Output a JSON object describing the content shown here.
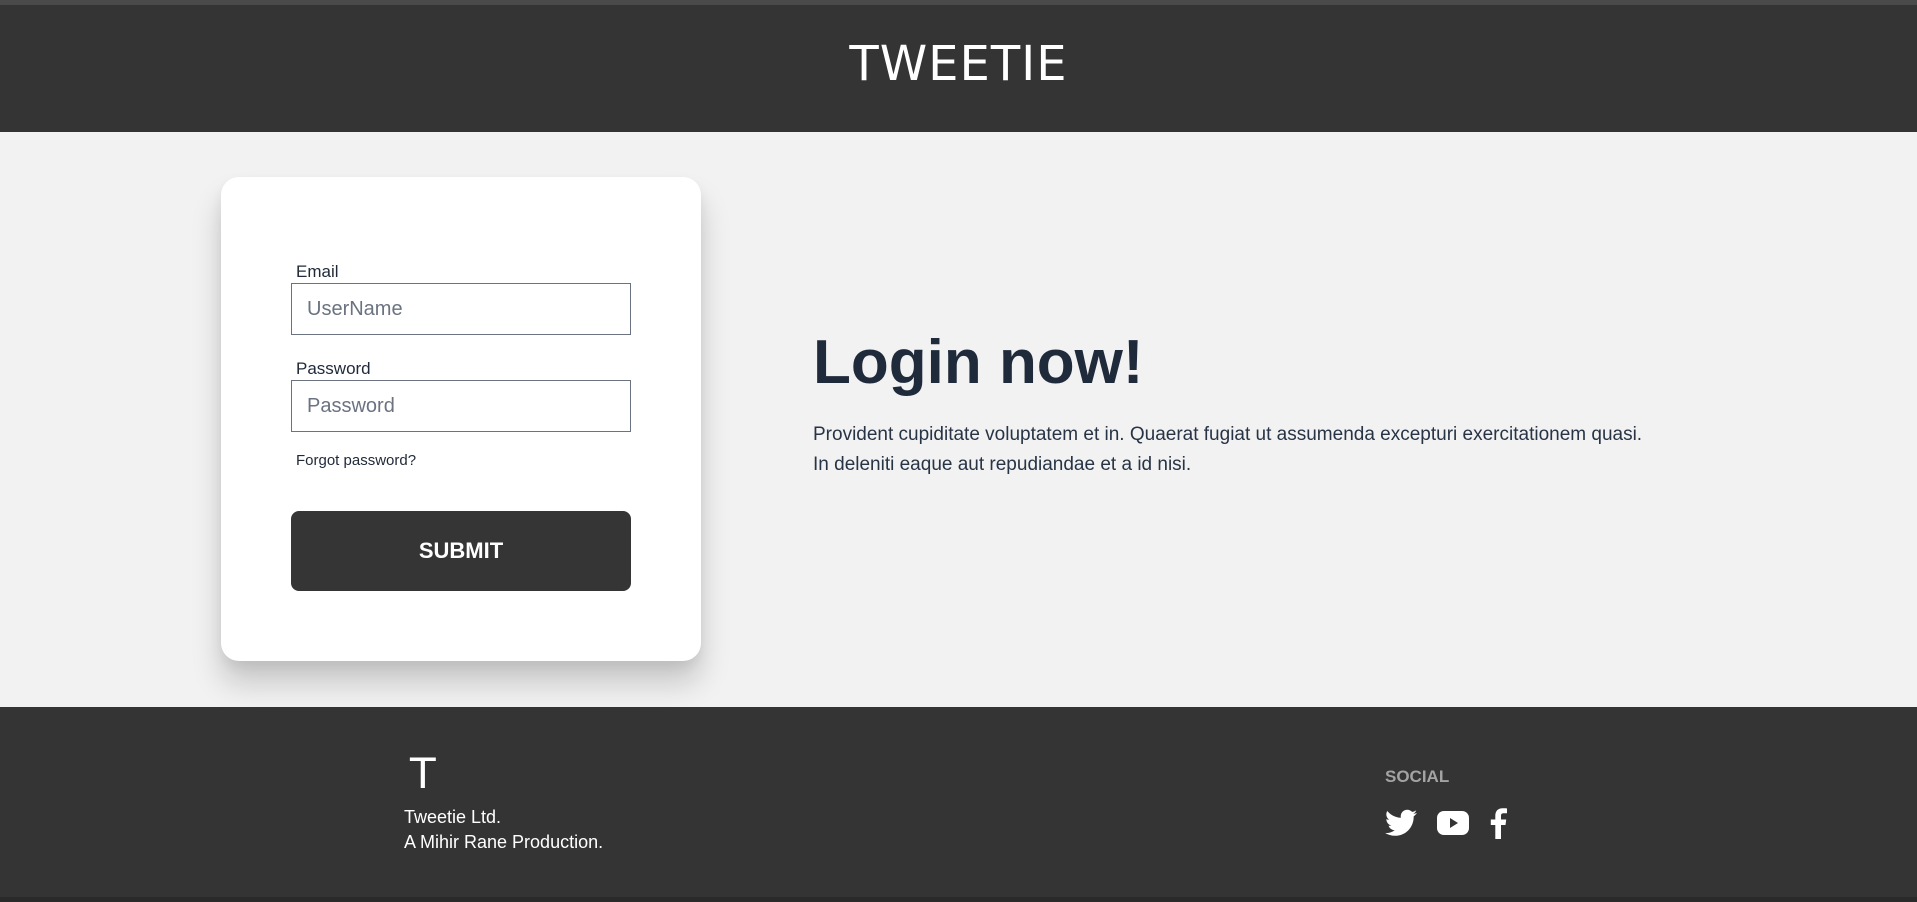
{
  "header": {
    "brand": "TWEETIE"
  },
  "login_form": {
    "email_label": "Email",
    "email_placeholder": "UserName",
    "password_label": "Password",
    "password_placeholder": "Password",
    "forgot_link": "Forgot password?",
    "submit_label": "SUBMIT"
  },
  "hero": {
    "title": "Login now!",
    "description": "Provident cupiditate voluptatem et in. Quaerat fugiat ut assumenda excepturi exercitationem quasi. In deleniti eaque aut repudiandae et a id nisi."
  },
  "footer": {
    "logo_mark": "T",
    "company_name": "Tweetie Ltd.",
    "tagline": "A Mihir Rane Production.",
    "social_title": "SOCIAL",
    "social_icons": [
      "twitter-icon",
      "youtube-icon",
      "facebook-icon"
    ]
  },
  "colors": {
    "header_bg": "#343434",
    "page_bg": "#f2f2f2",
    "button_bg": "#353535",
    "heading_text": "#1f2a3a"
  }
}
